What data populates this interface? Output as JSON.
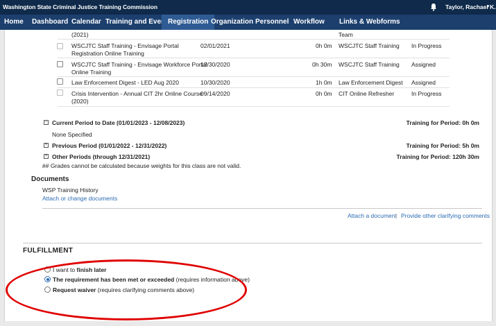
{
  "topbar": {
    "org": "Washington State Criminal Justice Training Commission",
    "user": "Taylor, Rachael K.",
    "caret": "▾"
  },
  "nav": [
    "Home",
    "Dashboard",
    "Calendar",
    "Training and Events",
    "Registration",
    "Organization",
    "Personnel",
    "Workflow",
    "Links & Webforms"
  ],
  "table": {
    "partial_top": {
      "title": "(2021)",
      "category": "Team"
    },
    "rows": [
      {
        "title_line1": "WSCJTC Staff Training - Envisage Portal",
        "title_line2": "Registration Online Training",
        "date": "02/01/2021",
        "hours": "0h 0m",
        "category": "WSCJTC Staff Training",
        "status": "In Progress"
      },
      {
        "title_line1": "WSCJTC Staff Training - Envisage Workforce Portal",
        "title_line2": "Online Training",
        "date": "12/30/2020",
        "hours": "0h 30m",
        "category": "WSCJTC Staff Training",
        "status": "Assigned"
      },
      {
        "title_line1": "Law Enforcement Digest - LED Aug 2020",
        "title_line2": "",
        "date": "10/30/2020",
        "hours": "1h 0m",
        "category": "Law Enforcement Digest",
        "status": "Assigned"
      },
      {
        "title_line1": "Crisis Intervention - Annual CIT 2hr Online Course",
        "title_line2": "(2020)",
        "date": "09/14/2020",
        "hours": "0h 0m",
        "category": "CIT Online Refresher",
        "status": "In Progress"
      }
    ]
  },
  "periods": {
    "current": {
      "label": "Current Period to Date (01/01/2023 - 12/08/2023)",
      "training": "Training for Period: 0h 0m",
      "toggle": "−"
    },
    "none": "None Specified",
    "previous": {
      "label": "Previous Period (01/01/2022 - 12/31/2022)",
      "training": "Training for Period: 5h 0m",
      "toggle": "+"
    },
    "other": {
      "label": "Other Periods (through 12/31/2021)",
      "training": "Training for Period: 120h 30m",
      "toggle": "+"
    },
    "note": "## Grades cannot be calculated because weights for this class are not valid."
  },
  "documents": {
    "heading": "Documents",
    "item": "WSP Training History",
    "attach_change": "Attach or change documents",
    "attach_doc": "Attach a document",
    "sep": "|",
    "clarify": "Provide other clarifying comments"
  },
  "fulfillment": {
    "heading": "FULFILLMENT",
    "opt1_pre": "I want to ",
    "opt1_bold": "finish later",
    "opt2_bold": "The requirement has been met or exceeded",
    "opt2_rest": " (requires information above)",
    "opt3_bold": "Request waiver",
    "opt3_rest": " (requires clarifying comments above)"
  },
  "colors": {
    "topbar": "#0f2a4a",
    "nav": "#1c3f6e",
    "nav_active": "#2f5b94",
    "link": "#2a6ab2",
    "highlight": "#e00000"
  }
}
